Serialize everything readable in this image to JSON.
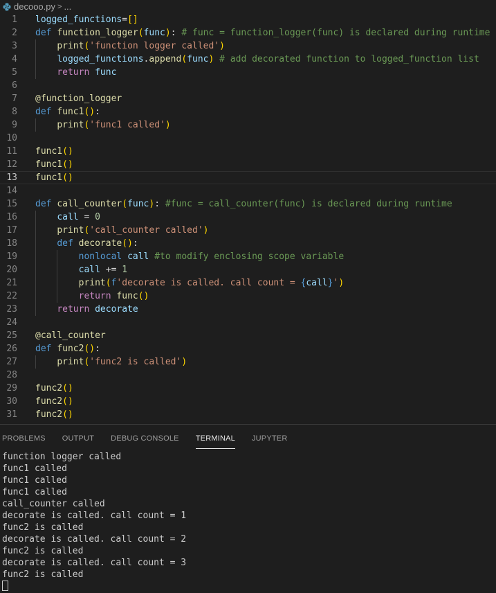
{
  "breadcrumb": {
    "file": "decooo.py",
    "separator": ">",
    "more": "..."
  },
  "editor": {
    "active_line": 13,
    "lines": [
      "logged_functions=[]",
      "def function_logger(func): # func = function_logger(func) is declared during runtime",
      "    print('function logger called')",
      "    logged_functions.append(func) # add decorated function to logged_function list",
      "    return func",
      "",
      "@function_logger",
      "def func1():",
      "    print('func1 called')",
      "",
      "func1()",
      "func1()",
      "func1()",
      "",
      "def call_counter(func): #func = call_counter(func) is declared during runtime",
      "    call = 0",
      "    print('call_counter called')",
      "    def decorate():",
      "        nonlocal call #to modify enclosing scope variable",
      "        call += 1",
      "        print(f'decorate is called. call count = {call}')",
      "        return func()",
      "    return decorate",
      "",
      "@call_counter",
      "def func2():",
      "    print('func2 is called')",
      "",
      "func2()",
      "func2()",
      "func2()"
    ]
  },
  "panel": {
    "tabs": [
      "PROBLEMS",
      "OUTPUT",
      "DEBUG CONSOLE",
      "TERMINAL",
      "JUPYTER"
    ],
    "active_tab": "TERMINAL",
    "terminal_lines": [
      "function logger called",
      "func1 called",
      "func1 called",
      "func1 called",
      "call_counter called",
      "decorate is called. call count = 1",
      "func2 is called",
      "decorate is called. call count = 2",
      "func2 is called",
      "decorate is called. call count = 3",
      "func2 is called"
    ]
  }
}
